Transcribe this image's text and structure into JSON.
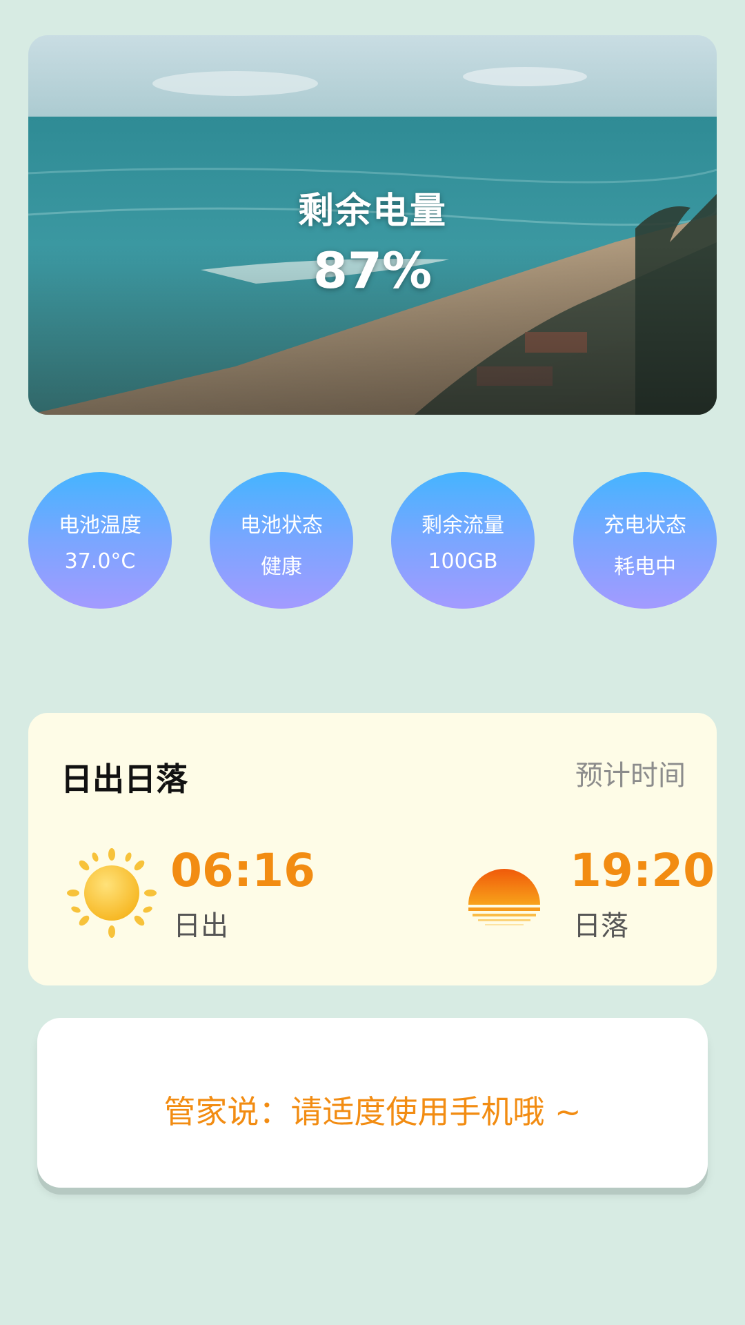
{
  "battery": {
    "label": "剩余电量",
    "value": "87%"
  },
  "stats": [
    {
      "title": "电池温度",
      "value": "37.0°C"
    },
    {
      "title": "电池状态",
      "value": "健康"
    },
    {
      "title": "剩余流量",
      "value": "100GB"
    },
    {
      "title": "充电状态",
      "value": "耗电中"
    }
  ],
  "sun": {
    "title": "日出日落",
    "subtitle": "预计时间",
    "sunrise_time": "06:16",
    "sunrise_label": "日出",
    "sunset_time": "19:20",
    "sunset_label": "日落"
  },
  "tip": {
    "text": "管家说：请适度使用手机哦 ~"
  },
  "colors": {
    "background": "#d7ebe3",
    "accent_orange": "#f28c12",
    "sun_card_bg": "#fefce7",
    "circle_top": "#45b4ff",
    "circle_bottom": "#a39aff"
  },
  "icons": {
    "hero_image": "beach-ocean-photo",
    "sunrise": "sun-icon",
    "sunset": "sunset-icon"
  }
}
